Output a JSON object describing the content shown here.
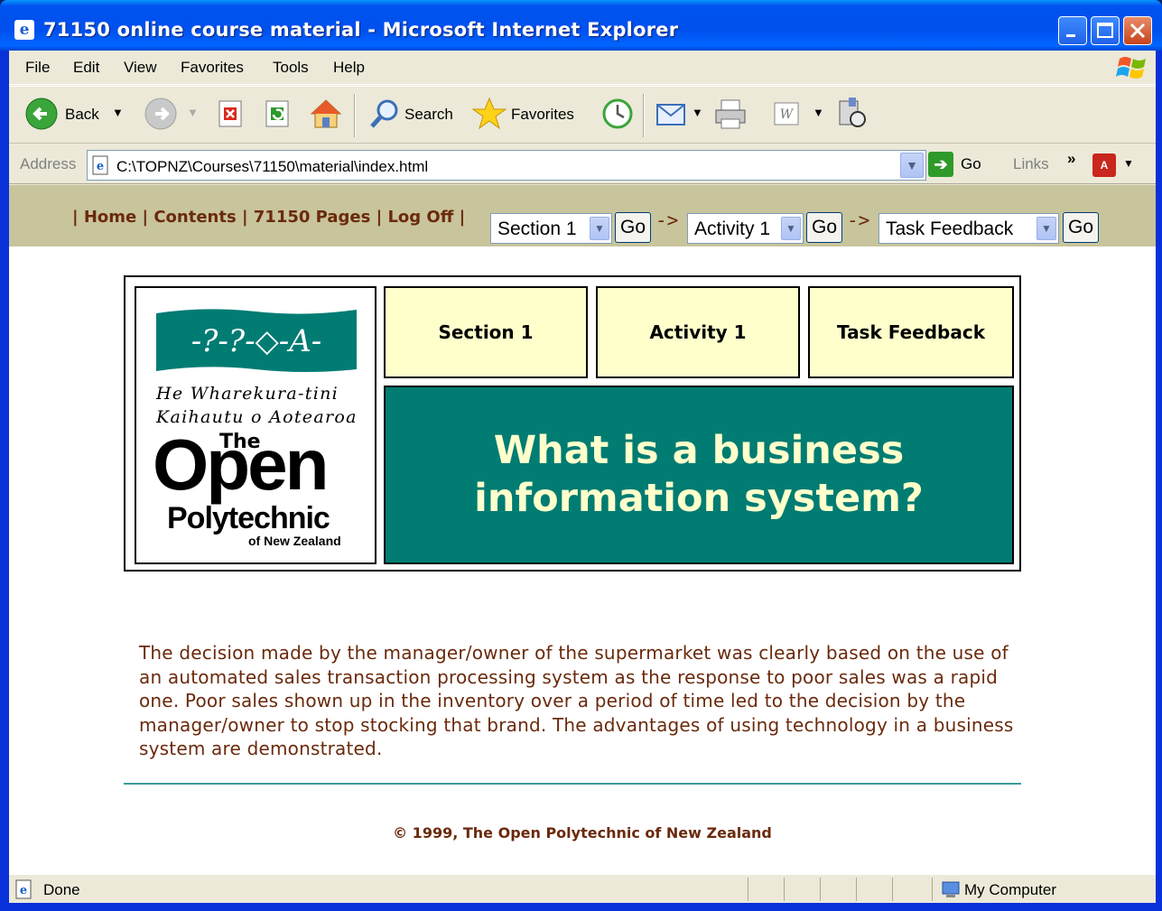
{
  "window": {
    "title": "71150 online course material - Microsoft Internet Explorer",
    "app_icon": "e"
  },
  "menu": {
    "items": [
      "File",
      "Edit",
      "View",
      "Favorites",
      "Tools",
      "Help"
    ]
  },
  "toolbar": {
    "back_label": "Back",
    "search_label": "Search",
    "favorites_label": "Favorites"
  },
  "address": {
    "label": "Address",
    "url": "C:\\TOPNZ\\Courses\\71150\\material\\index.html",
    "go_label": "Go",
    "links_label": "Links",
    "links_more": "»"
  },
  "course_nav": {
    "links_text": "| Home | Contents | 71150 Pages | Log Off |",
    "section_select": "Section 1",
    "activity_select": "Activity 1",
    "task_select": "Task Feedback",
    "go_label": "Go",
    "arrow": "->"
  },
  "header": {
    "logo": {
      "maori_line1": "He Wharekura-tini",
      "maori_line2": "Kaihautu o Aotearoa",
      "the": "The",
      "open": "Open",
      "polytechnic": "Polytechnic",
      "nz": "of New Zealand",
      "banner_text": "-?-?-◇-A-"
    },
    "tabs": [
      "Section 1",
      "Activity 1",
      "Task Feedback"
    ],
    "title": "What is a business information system?"
  },
  "content": {
    "paragraph": "The decision made by the manager/owner of the supermarket was clearly based on the use of an automated sales transaction processing system as the response to poor sales was a rapid one. Poor sales shown up in the inventory over a period of time led to the decision by the manager/owner to stop stocking that brand. The advantages of using technology in a business system are demonstrated."
  },
  "footer": {
    "copyright": "© 1999, The Open Polytechnic of New Zealand"
  },
  "status": {
    "text": "Done",
    "zone": "My Computer"
  },
  "colors": {
    "nav_bg": "#c8c49c",
    "nav_text": "#6a2a0c",
    "tab_bg": "#ffffcc",
    "title_bg": "#007c73",
    "title_text": "#ffffcc"
  }
}
